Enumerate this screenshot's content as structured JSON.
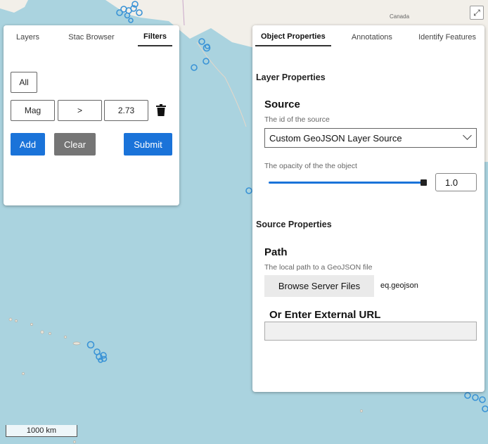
{
  "map": {
    "label_canada": "Canada",
    "scale_label": "1000 km",
    "expand_icon": "expand-icon"
  },
  "left_panel": {
    "tabs": [
      {
        "label": "Layers",
        "active": false
      },
      {
        "label": "Stac Browser",
        "active": false
      },
      {
        "label": "Filters",
        "active": true
      }
    ],
    "all_button": "All",
    "filter": {
      "feature": "Mag",
      "operator": ">",
      "value": "2.73"
    },
    "delete_icon": "trash-icon",
    "add_button": "Add",
    "clear_button": "Clear",
    "submit_button": "Submit"
  },
  "right_panel": {
    "tabs": [
      {
        "label": "Object Properties",
        "active": true
      },
      {
        "label": "Annotations",
        "active": false
      },
      {
        "label": "Identify Features",
        "active": false
      }
    ],
    "layer_properties_title": "Layer Properties",
    "source": {
      "heading": "Source",
      "description": "The id of the source",
      "selected": "Custom GeoJSON Layer Source"
    },
    "opacity": {
      "description": "The opacity of the the object",
      "value": "1.0"
    },
    "source_properties_title": "Source Properties",
    "path": {
      "heading": "Path",
      "description": "The local path to a GeoJSON file",
      "browse_button": "Browse Server Files",
      "file": "eq.geojson"
    },
    "external_url": {
      "heading": "Or Enter External URL",
      "value": ""
    }
  },
  "colors": {
    "accent": "#1a73d9",
    "water": "#aad3df",
    "land": "#f2efe9",
    "marker": "#3a93d6"
  }
}
